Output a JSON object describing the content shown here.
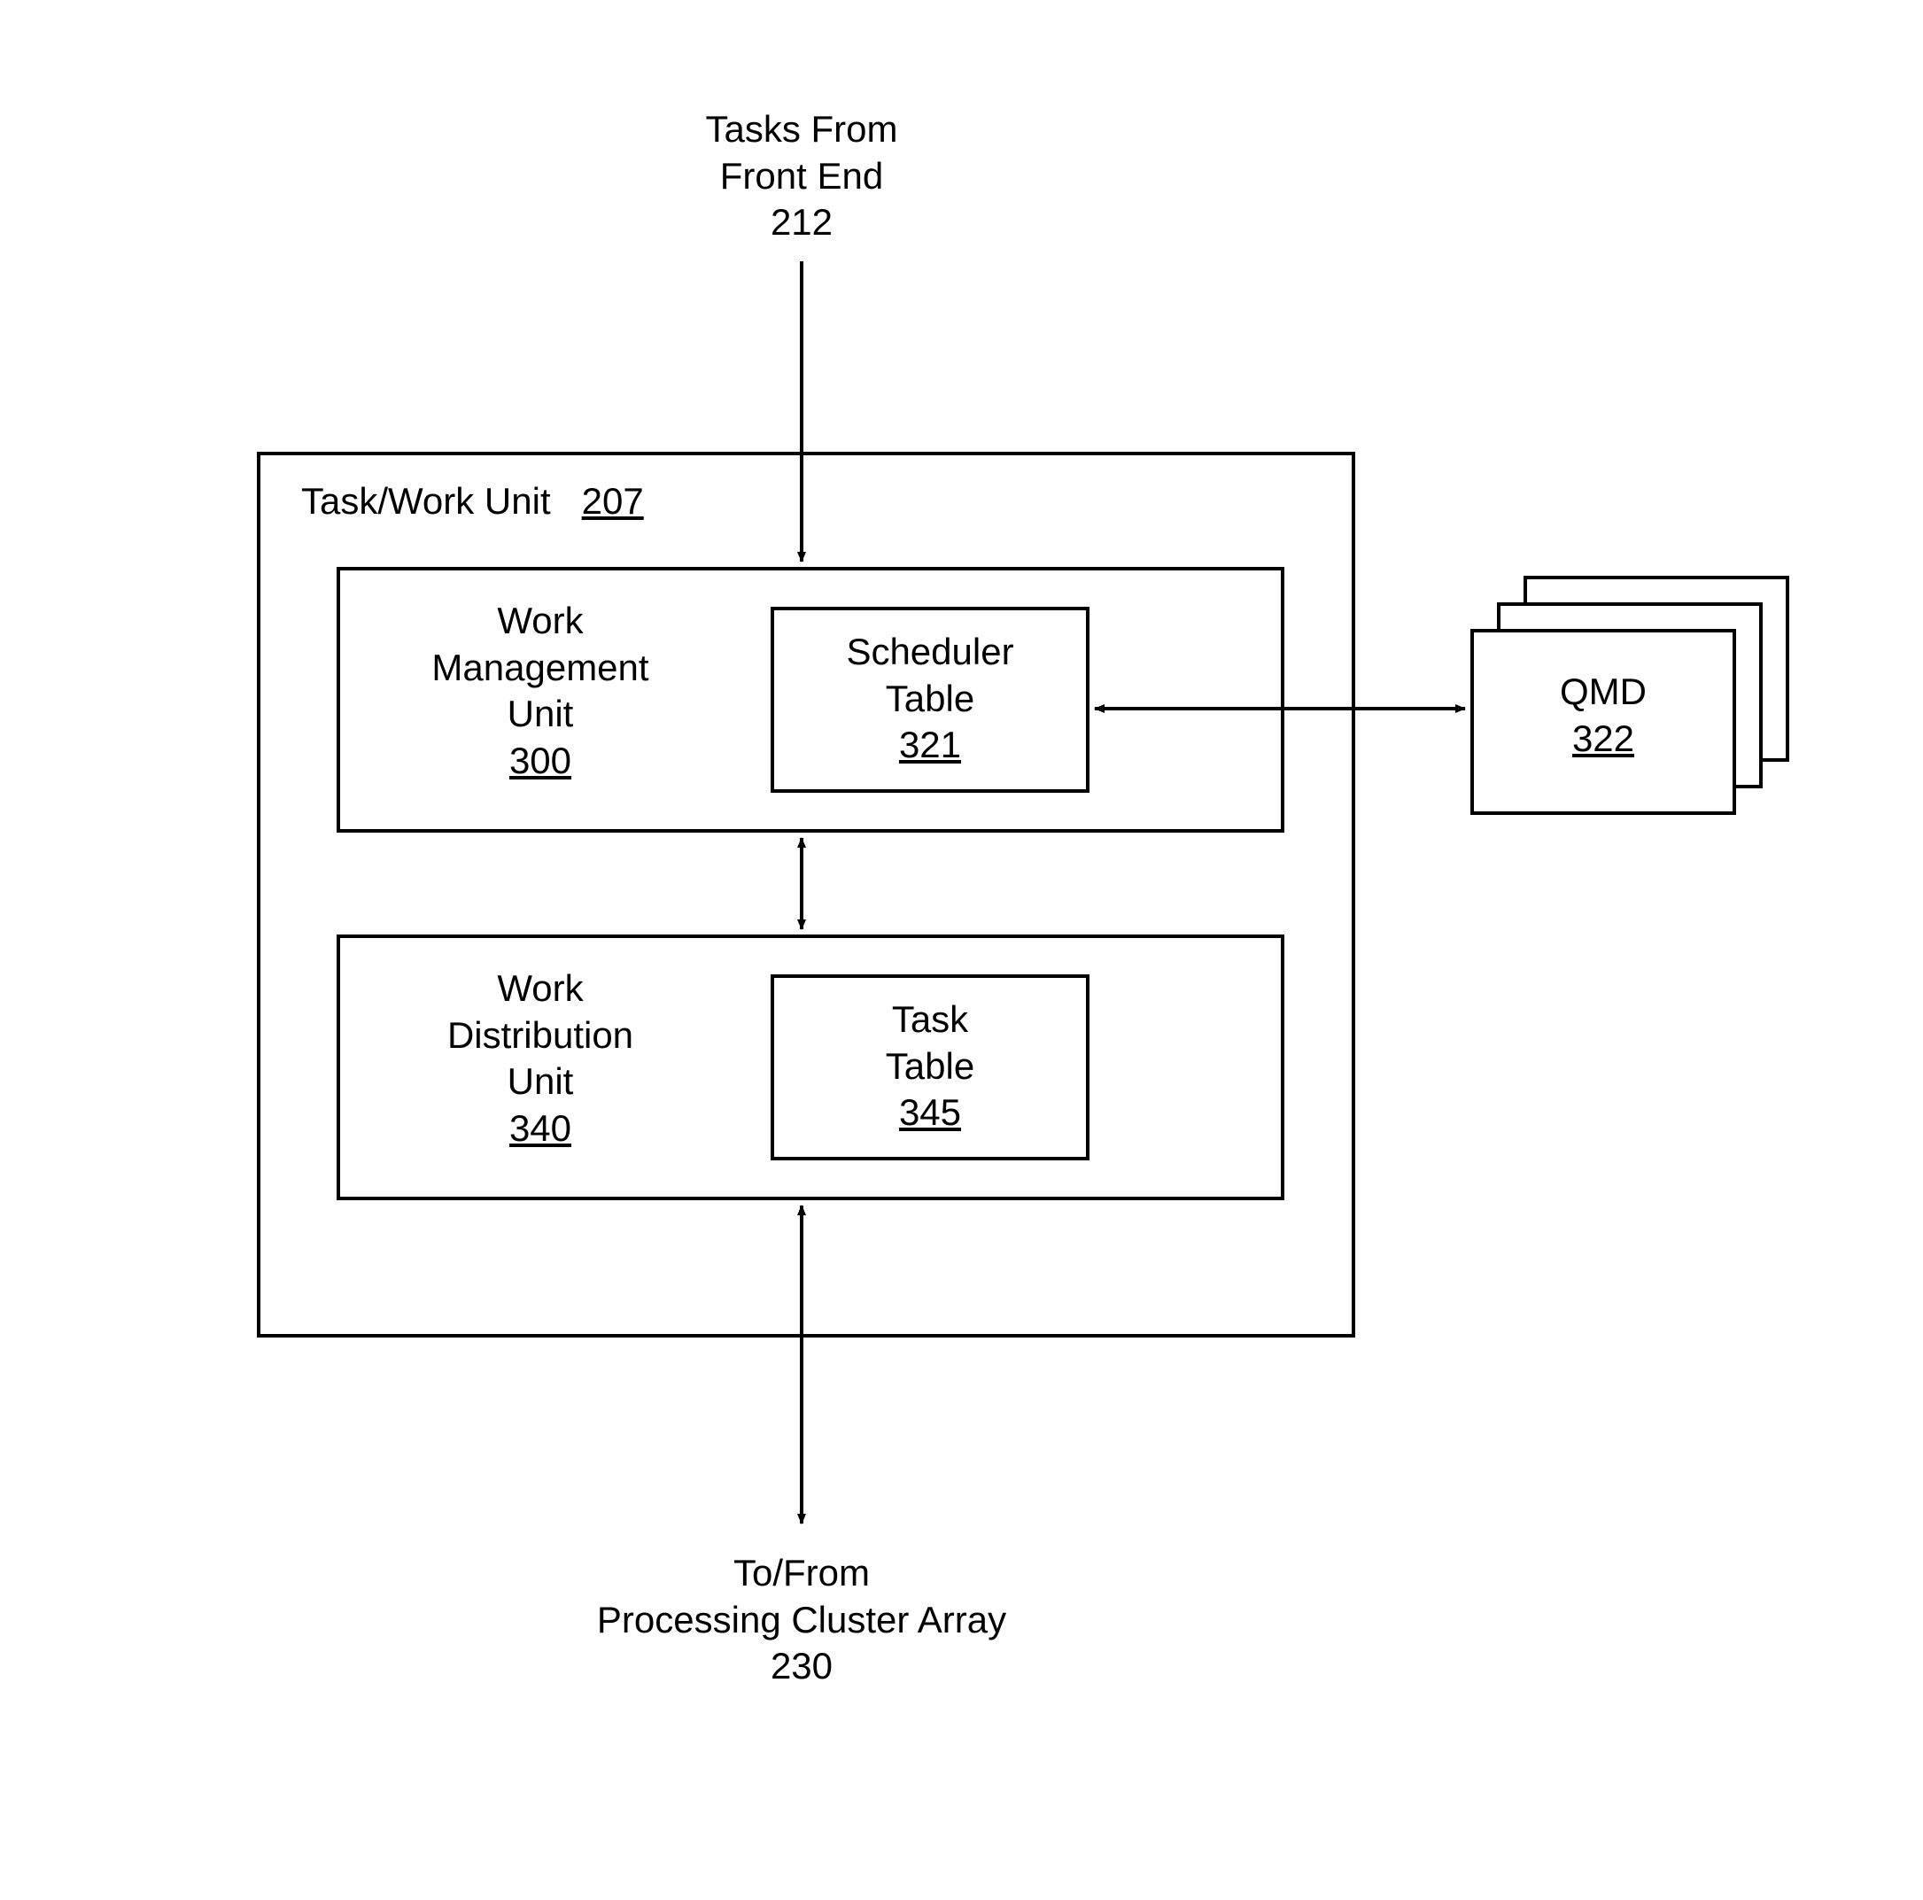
{
  "top_label": {
    "line1": "Tasks From",
    "line2": "Front End",
    "ref": "212"
  },
  "container": {
    "label": "Task/Work Unit",
    "ref": "207"
  },
  "wmu": {
    "line1": "Work",
    "line2": "Management",
    "line3": "Unit",
    "ref": "300"
  },
  "scheduler": {
    "line1": "Scheduler",
    "line2": "Table",
    "ref": "321"
  },
  "wdu": {
    "line1": "Work",
    "line2": "Distribution",
    "line3": "Unit",
    "ref": "340"
  },
  "task_table": {
    "line1": "Task",
    "line2": "Table",
    "ref": "345"
  },
  "qmd": {
    "label": "QMD",
    "ref": "322"
  },
  "bottom_label": {
    "line1": "To/From",
    "line2": "Processing Cluster Array",
    "ref": "230"
  }
}
